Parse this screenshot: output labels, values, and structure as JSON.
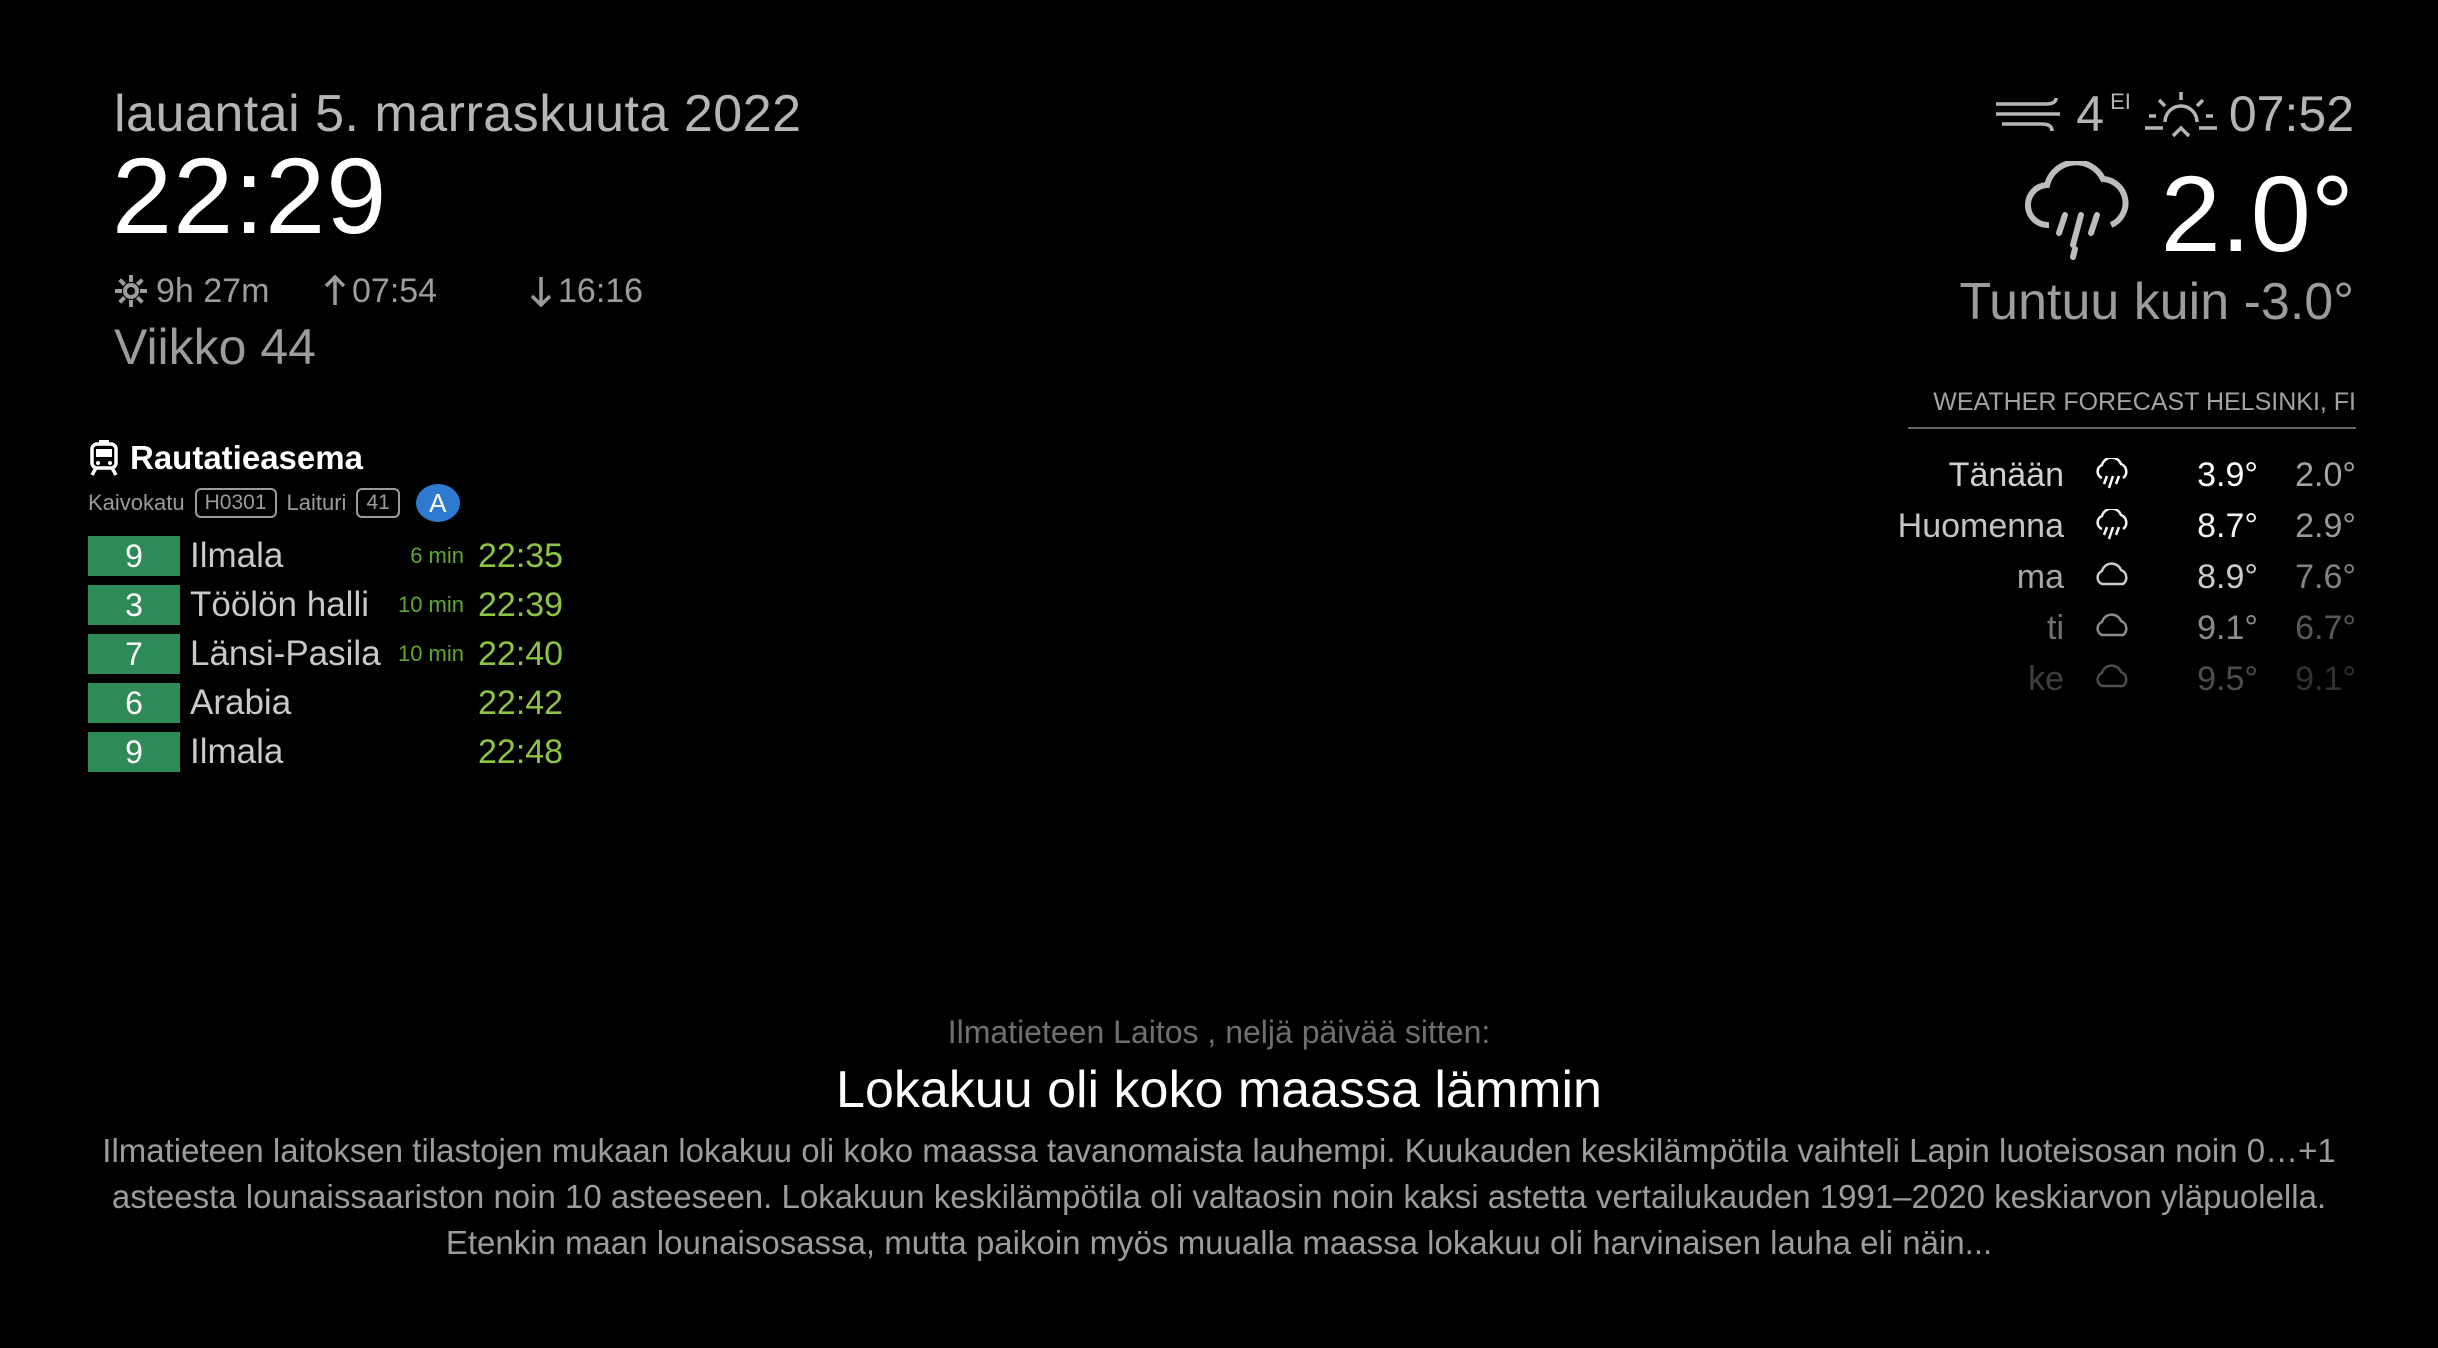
{
  "clock": {
    "date": "lauantai 5. marraskuuta 2022",
    "time": "22:29",
    "daylength": "9h 27m",
    "sunrise": "07:54",
    "sunset": "16:16",
    "week": "Viikko 44"
  },
  "transit": {
    "stop_name": "Rautatieasema",
    "street": "Kaivokatu",
    "stop_code": "H0301",
    "platform_label": "Laituri",
    "platform": "41",
    "platform_letter": "A",
    "line_color": "#2e8b57",
    "departures": [
      {
        "line": "9",
        "destination": "Ilmala",
        "minutes": "6 min",
        "time": "22:35"
      },
      {
        "line": "3",
        "destination": "Töölön halli",
        "minutes": "10 min",
        "time": "22:39"
      },
      {
        "line": "7",
        "destination": "Länsi-Pasila",
        "minutes": "10 min",
        "time": "22:40"
      },
      {
        "line": "6",
        "destination": "Arabia",
        "minutes": "",
        "time": "22:42"
      },
      {
        "line": "9",
        "destination": "Ilmala",
        "minutes": "",
        "time": "22:48"
      }
    ]
  },
  "current_weather": {
    "wind_speed": "4",
    "wind_dir": "EI",
    "sun_time": "07:52",
    "temperature": "2.0°",
    "feels_like": "Tuntuu kuin -3.0°",
    "icon": "rain-cloud-icon"
  },
  "forecast": {
    "header": "WEATHER FORECAST HELSINKI, FI",
    "rows": [
      {
        "day": "Tänään",
        "icon": "rain-icon",
        "max": "3.9°",
        "min": "2.0°"
      },
      {
        "day": "Huomenna",
        "icon": "rain-icon",
        "max": "8.7°",
        "min": "2.9°"
      },
      {
        "day": "ma",
        "icon": "cloud-icon",
        "max": "8.9°",
        "min": "7.6°"
      },
      {
        "day": "ti",
        "icon": "cloud-icon",
        "max": "9.1°",
        "min": "6.7°"
      },
      {
        "day": "ke",
        "icon": "cloud-icon",
        "max": "9.5°",
        "min": "9.1°"
      }
    ]
  },
  "news": {
    "source": "Ilmatieteen Laitos , neljä päivää sitten:",
    "title": "Lokakuu oli koko maassa lämmin",
    "body": "Ilmatieteen laitoksen tilastojen mukaan lokakuu oli koko maassa tavanomaista lauhempi. Kuukauden keskilämpötila vaihteli Lapin luoteisosan noin 0…+1 asteesta lounaissaariston noin 10 asteeseen. Lokakuun keskilämpötila oli valtaosin noin kaksi astetta vertailukauden 1991–2020 keskiarvon yläpuolella. Etenkin maan lounaisosassa, mutta paikoin myös muualla maassa lokakuu oli harvinaisen lauha eli näin..."
  }
}
